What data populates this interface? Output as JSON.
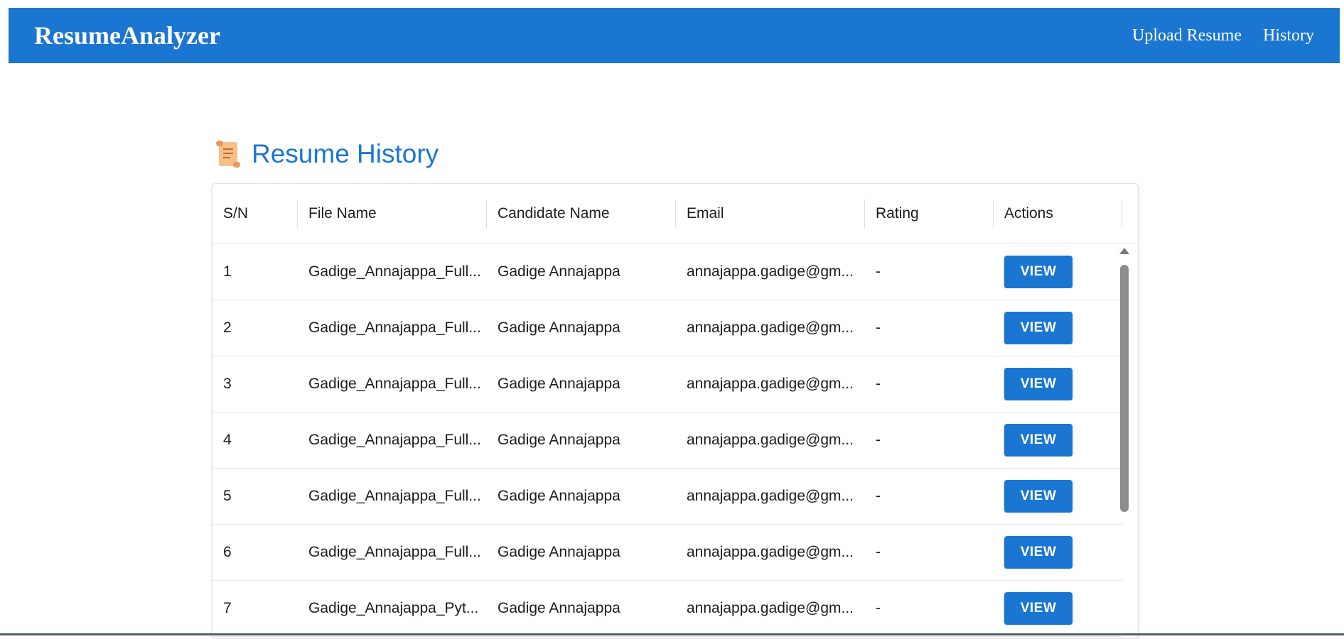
{
  "appbar": {
    "brand": "ResumeAnalyzer",
    "nav": [
      "Upload Resume",
      "History"
    ]
  },
  "page": {
    "title": "Resume History",
    "icon": "scroll-icon"
  },
  "table": {
    "headers": [
      "S/N",
      "File Name",
      "Candidate Name",
      "Email",
      "Rating",
      "Actions"
    ],
    "rows": [
      {
        "sn": "1",
        "file": "Gadige_Annajappa_Full...",
        "name": "Gadige Annajappa",
        "email": "annajappa.gadige@gm...",
        "rating": "-",
        "action": "VIEW"
      },
      {
        "sn": "2",
        "file": "Gadige_Annajappa_Full...",
        "name": "Gadige Annajappa",
        "email": "annajappa.gadige@gm...",
        "rating": "-",
        "action": "VIEW"
      },
      {
        "sn": "3",
        "file": "Gadige_Annajappa_Full...",
        "name": "Gadige Annajappa",
        "email": "annajappa.gadige@gm...",
        "rating": "-",
        "action": "VIEW"
      },
      {
        "sn": "4",
        "file": "Gadige_Annajappa_Full...",
        "name": "Gadige Annajappa",
        "email": "annajappa.gadige@gm...",
        "rating": "-",
        "action": "VIEW"
      },
      {
        "sn": "5",
        "file": "Gadige_Annajappa_Full...",
        "name": "Gadige Annajappa",
        "email": "annajappa.gadige@gm...",
        "rating": "-",
        "action": "VIEW"
      },
      {
        "sn": "6",
        "file": "Gadige_Annajappa_Full...",
        "name": "Gadige Annajappa",
        "email": "annajappa.gadige@gm...",
        "rating": "-",
        "action": "VIEW"
      },
      {
        "sn": "7",
        "file": "Gadige_Annajappa_Pyt...",
        "name": "Gadige Annajappa",
        "email": "annajappa.gadige@gm...",
        "rating": "-",
        "action": "VIEW"
      }
    ]
  },
  "colors": {
    "primary": "#1b76d2",
    "text": "#1c1c1c"
  }
}
